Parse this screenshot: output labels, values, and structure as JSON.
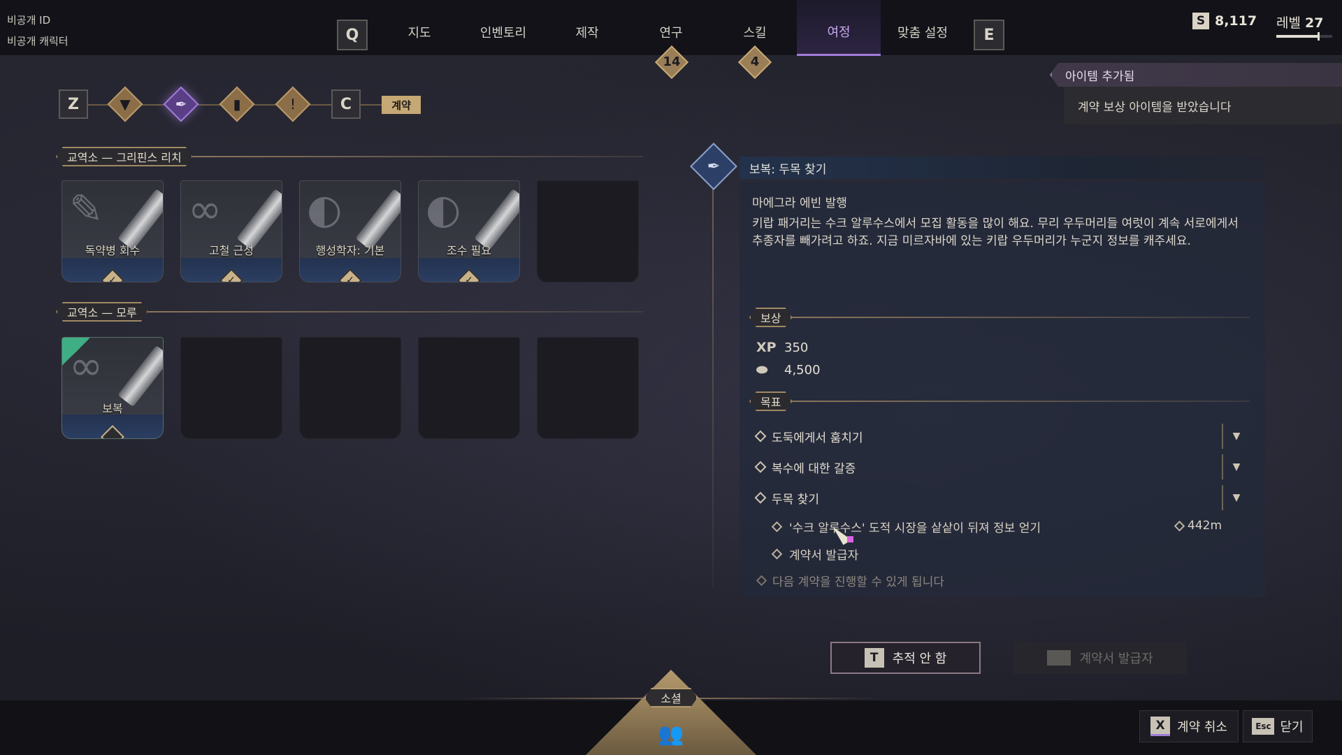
{
  "account": {
    "id_label": "비공개 ID",
    "character_label": "비공개 캐릭터"
  },
  "nav": {
    "key_left": "Q",
    "key_right": "E",
    "tabs": [
      {
        "label": "지도"
      },
      {
        "label": "인벤토리"
      },
      {
        "label": "제작"
      },
      {
        "label": "연구",
        "badge": "14"
      },
      {
        "label": "스킬",
        "badge": "4"
      },
      {
        "label": "여정",
        "active": true
      },
      {
        "label": "맞춤 설정"
      }
    ]
  },
  "currency": {
    "icon": "S",
    "amount": "8,117"
  },
  "level": {
    "label": "레벨",
    "value": "27",
    "progress": 0.78
  },
  "notification": {
    "title": "아이템 추가됨",
    "message": "계약 보상 아이템을 받았습니다"
  },
  "categories": {
    "key_left": "Z",
    "key_right": "C",
    "icons": [
      "bookmark-icon",
      "pen-nib-icon",
      "card-icon",
      "alert-scroll-icon"
    ],
    "active_index": 1,
    "active_label": "계약"
  },
  "sections": [
    {
      "title": "교역소 — 그리핀스 리치",
      "cards": [
        {
          "label": "독약병 회수",
          "glyph": "scroll-icon",
          "completed": true
        },
        {
          "label": "고철 근성",
          "glyph": "chain-icon",
          "completed": true
        },
        {
          "label": "행성학자: 기본",
          "glyph": "planet-icon",
          "completed": true
        },
        {
          "label": "조수 필요",
          "glyph": "planet-icon",
          "completed": true
        }
      ]
    },
    {
      "title": "교역소 — 모루",
      "cards": [
        {
          "label": "보복",
          "glyph": "chain-icon",
          "completed": false,
          "new": true
        }
      ]
    }
  ],
  "detail": {
    "title": "보복: 두목 찾기",
    "issuer": "마에그라 에빈 발행",
    "description": "키랍 패거리는 수크 알루수스에서 모집 활동을 많이 해요. 무리 우두머리들 여럿이 계속 서로에게서 추종자를 빼가려고 하죠. 지금 미르자바에 있는 키랍 우두머리가 누군지 정보를 캐주세요.",
    "rewards_label": "보상",
    "rewards": [
      {
        "icon": "XP",
        "value": "350"
      },
      {
        "icon": "credits-icon",
        "value": "4,500"
      }
    ],
    "objectives_label": "목표",
    "objectives": [
      {
        "label": "도둑에게서 훔치기",
        "done": true
      },
      {
        "label": "복수에 대한 갈증",
        "done": true
      },
      {
        "label": "두목 찾기",
        "done": false
      }
    ],
    "sub_objectives": [
      {
        "label": "'수크 알루수스' 도적 시장을 샅샅이 뒤져 정보 얻기",
        "distance": "442m"
      },
      {
        "label": "계약서 발급자"
      }
    ],
    "unlock_text": "다음 계약을 진행할 수 있게 됩니다"
  },
  "buttons": {
    "track": {
      "key": "T",
      "label": "추적 안 함"
    },
    "issuer": {
      "label": "계약서 발급자"
    },
    "cancel": {
      "key": "X",
      "label": "계약 취소"
    },
    "close": {
      "key": "Esc",
      "label": "닫기"
    }
  },
  "social": {
    "label": "소셜",
    "icon": "people-icon"
  },
  "colors": {
    "accent_purple": "#a07cd8",
    "gold": "#c6a874",
    "active_tab_bg": "#2d2442"
  }
}
